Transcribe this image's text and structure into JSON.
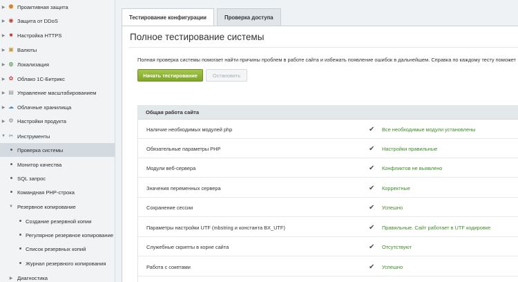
{
  "sidebar": {
    "items": [
      {
        "label": "Проактивная защита",
        "icon": "shield-icon",
        "glyph": "🛡",
        "color": "#d9822b"
      },
      {
        "label": "Защита от DDoS",
        "icon": "ddos-icon",
        "glyph": "◉",
        "color": "#c23a2b"
      },
      {
        "label": "Настройка HTTPS",
        "icon": "lock-icon",
        "glyph": "■",
        "color": "#d4373a"
      },
      {
        "label": "Валюты",
        "icon": "currency-icon",
        "glyph": "▣",
        "color": "#c79a3a"
      },
      {
        "label": "Локализация",
        "icon": "globe-icon",
        "glyph": "◍",
        "color": "#3b8f3d"
      },
      {
        "label": "Облако 1С-Битрикс",
        "icon": "cloud-bitrix-icon",
        "glyph": "✿",
        "color": "#c8362c"
      },
      {
        "label": "Управление масштабированием",
        "icon": "scaling-icon",
        "glyph": "▤",
        "color": "#8a9196"
      },
      {
        "label": "Облачные хранилища",
        "icon": "cloud-storage-icon",
        "glyph": "☁",
        "color": "#4c8ec2"
      },
      {
        "label": "Настройки продукта",
        "icon": "settings-icon",
        "glyph": "⚙",
        "color": "#7b8288"
      },
      {
        "label": "Инструменты",
        "icon": "tools-icon",
        "glyph": "✂",
        "color": "#5b84b0"
      },
      {
        "label": "Проверка системы"
      },
      {
        "label": "Монитор качества"
      },
      {
        "label": "SQL запрос"
      },
      {
        "label": "Командная PHP-строка"
      },
      {
        "label": "Резервное копирование"
      },
      {
        "label": "Создание резервной копии"
      },
      {
        "label": "Регулярное резервное копирование"
      },
      {
        "label": "Список резервных копий"
      },
      {
        "label": "Журнал резервного копирования"
      },
      {
        "label": "Диагностика"
      }
    ]
  },
  "tabs": [
    {
      "label": "Тестирование конфигурации",
      "active": true
    },
    {
      "label": "Проверка доступа",
      "active": false
    }
  ],
  "main": {
    "title": "Полное тестирование системы",
    "description": "Полная проверка системы помогает найти причины проблем в работе сайта и избежать появление ошибок в дальнейшем. Справка по каждому тесту поможет",
    "start_button": "Начать тестирование",
    "stop_button": "Остановить",
    "section_title": "Общая работа сайта",
    "rows": [
      {
        "name": "Наличие необходимых модулей php",
        "status": "Все необходимые модули установлены"
      },
      {
        "name": "Обязательные параметры PHP",
        "status": "Настройки правильные"
      },
      {
        "name": "Модули веб-сервера",
        "status": "Конфликтов не выявлено"
      },
      {
        "name": "Значения переменных сервера",
        "status": "Корректные"
      },
      {
        "name": "Сохранение сессии",
        "status": "Успешно"
      },
      {
        "name": "Параметры настройки UTF (mbstring и константа BX_UTF)",
        "status": "Правильные. Сайт работает в UTF кодировке"
      },
      {
        "name": "Служебные скрипты в корне сайта",
        "status": "Отсутствуют"
      },
      {
        "name": "Работа с сокетами",
        "status": "Успешно"
      }
    ],
    "check_glyph": "✔"
  },
  "colors": {
    "accent_green": "#8ab535",
    "status_green": "#3f8a2a",
    "active_nav": "#d4dbe0"
  }
}
